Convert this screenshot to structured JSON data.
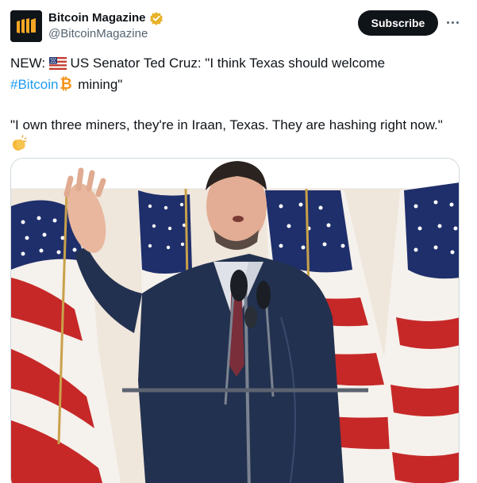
{
  "tweet": {
    "author_name": "Bitcoin Magazine",
    "author_handle": "@BitcoinMagazine",
    "subscribe_label": "Subscribe",
    "text_prefix": "NEW: ",
    "text_line1_rest": " US Senator Ted Cruz: \"I think Texas should welcome",
    "hashtag": "#Bitcoin",
    "text_line2_rest": " mining\"",
    "quote": "\"I own three miners, they're in Iraan, Texas. They are hashing right now.\""
  },
  "icons": {
    "avatar": "bitcoin-magazine-logo",
    "verified": "verified-badge-icon",
    "more": "more-options-icon",
    "flag": "us-flag-emoji",
    "bitcoin": "bitcoin-emoji",
    "clap": "clapping-hands-emoji"
  },
  "colors": {
    "hashtag": "#1d9bf0",
    "verified": "#e8b22a",
    "subscribe_bg": "#0f1419"
  }
}
